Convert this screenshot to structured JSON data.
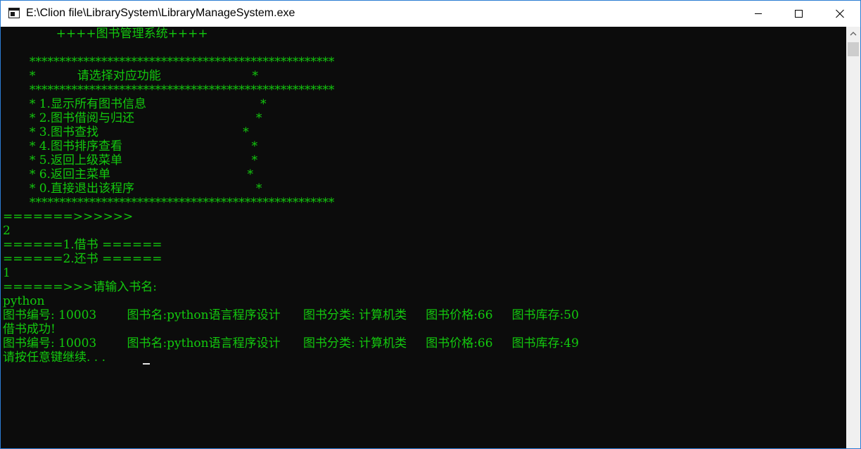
{
  "window": {
    "title": "E:\\Clion file\\LibrarySystem\\LibraryManageSystem.exe",
    "icons": {
      "app": "console-window-icon",
      "minimize": "minimize-icon",
      "maximize": "maximize-icon",
      "close": "close-icon",
      "scroll_up": "chevron-up-icon"
    }
  },
  "console": {
    "text_color": "#13c90e",
    "background": "#0c0c0c",
    "lines": [
      "              ++++图书管理系统++++",
      "",
      "       ***************************************************",
      "       *           请选择对应功能                        *",
      "       ***************************************************",
      "       * 1.显示所有图书信息                              *",
      "       * 2.图书借阅与归还                                *",
      "       * 3.图书查找                                      *",
      "       * 4.图书排序查看                                  *",
      "       * 5.返回上级菜单                                  *",
      "       * 6.返回主菜单                                    *",
      "       * 0.直接退出该程序                                *",
      "       ***************************************************",
      "=======>>>>>>",
      "2",
      "======1.借书 ======",
      "======2.还书 ======",
      "1",
      "======>>>请输入书名:",
      "python",
      "图书编号: 10003        图书名:python语言程序设计      图书分类: 计算机类     图书价格:66     图书库存:50",
      "借书成功!",
      "图书编号: 10003        图书名:python语言程序设计      图书分类: 计算机类     图书价格:66     图书库存:49",
      "请按任意键继续. . . "
    ]
  }
}
